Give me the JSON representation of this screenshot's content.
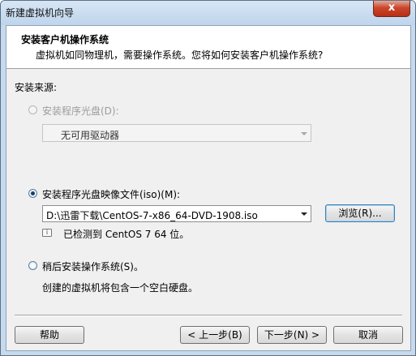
{
  "window": {
    "title": "新建虚拟机向导",
    "close_label": "x"
  },
  "header": {
    "title": "安装客户机操作系统",
    "description": "虚拟机如同物理机，需要操作系统。您将如何安装客户机操作系统?"
  },
  "source": {
    "label": "安装来源:",
    "disc_option": {
      "label": "安装程序光盘(D):",
      "selected": false,
      "enabled": false
    },
    "disc_drive": {
      "value": "无可用驱动器"
    },
    "iso_option": {
      "label": "安装程序光盘映像文件(iso)(M):",
      "selected": true
    },
    "iso_path": {
      "value": "D:\\迅雷下载\\CentOS-7-x86_64-DVD-1908.iso"
    },
    "browse_label": "浏览(R)...",
    "detected_text": "已检测到 CentOS 7 64 位。",
    "later_option": {
      "label": "稍后安装操作系统(S)。",
      "selected": false
    },
    "later_desc": "创建的虚拟机将包含一个空白硬盘。"
  },
  "footer": {
    "help_label": "帮助",
    "back_label": "< 上一步(B)",
    "next_label": "下一步(N) >",
    "cancel_label": "取消"
  }
}
